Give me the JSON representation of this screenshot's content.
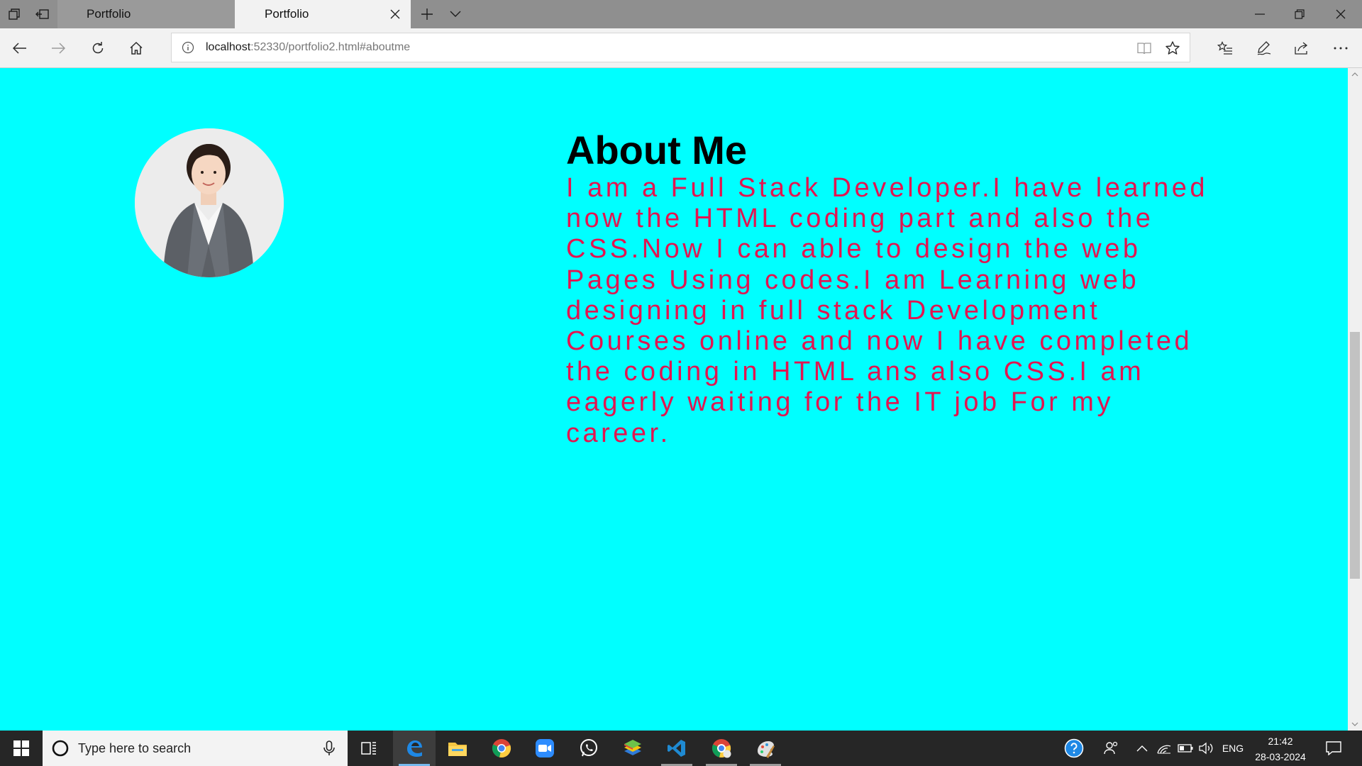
{
  "browser": {
    "tabs": [
      {
        "title": "Portfolio",
        "active": false
      },
      {
        "title": "Portfolio",
        "active": true
      }
    ],
    "url": {
      "host": "localhost",
      "rest": ":52330/portfolio2.html#aboutme"
    }
  },
  "about": {
    "heading": "About Me",
    "text": "I am a Full Stack Developer.I have learned now the HTML coding part and also the CSS.Now I can able to design the web Pages Using codes.I am Learning web designing in full stack Development Courses online and now I have completed the coding in HTML ans also CSS.I am eagerly waiting for the IT job For my career."
  },
  "taskbar": {
    "search_placeholder": "Type here to search",
    "language": "ENG",
    "time": "21:42",
    "date": "28-03-2024"
  },
  "colors": {
    "page_background": "#00ffff",
    "about_text": "#e21550",
    "heading": "#000000"
  }
}
